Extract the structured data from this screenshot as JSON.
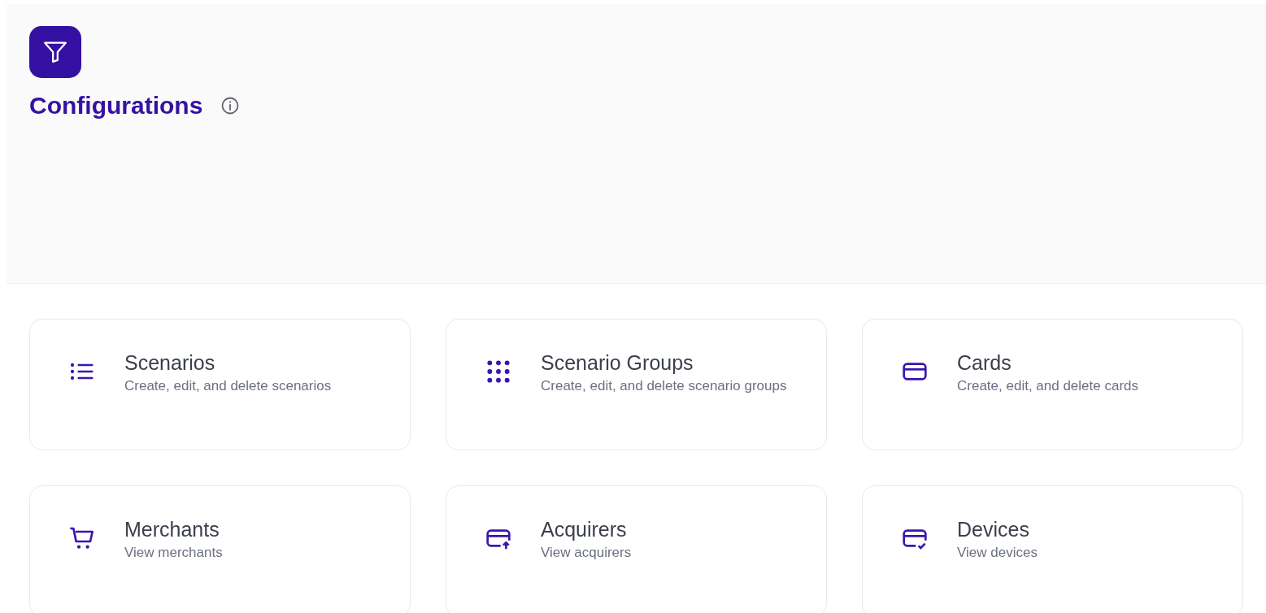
{
  "header": {
    "title": "Configurations"
  },
  "cards": [
    {
      "title": "Scenarios",
      "description": "Create, edit, and delete scenarios"
    },
    {
      "title": "Scenario Groups",
      "description": "Create, edit, and delete scenario groups"
    },
    {
      "title": "Cards",
      "description": "Create, edit, and delete cards"
    },
    {
      "title": "Merchants",
      "description": "View merchants"
    },
    {
      "title": "Acquirers",
      "description": "View acquirers"
    },
    {
      "title": "Devices",
      "description": "View devices"
    }
  ]
}
